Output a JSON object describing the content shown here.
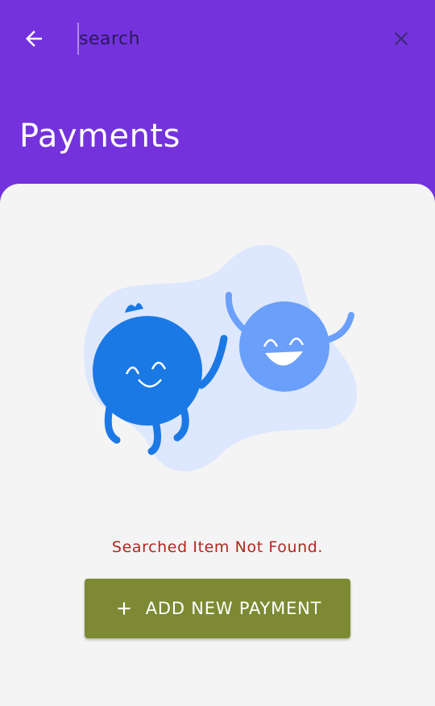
{
  "header": {
    "back_icon": "arrow-left-icon",
    "search_placeholder": "search",
    "search_value": "",
    "clear_icon": "close-icon",
    "title": "Payments"
  },
  "empty_state": {
    "message": "Searched Item Not Found.",
    "illustration": "two-happy-blobs-illustration"
  },
  "actions": {
    "add_icon": "plus-icon",
    "add_label": "ADD NEW PAYMENT"
  },
  "colors": {
    "app_bar": "#7432dd",
    "content_bg": "#f4f4f4",
    "error_text": "#b3261e",
    "button_bg": "#7d8a33"
  }
}
